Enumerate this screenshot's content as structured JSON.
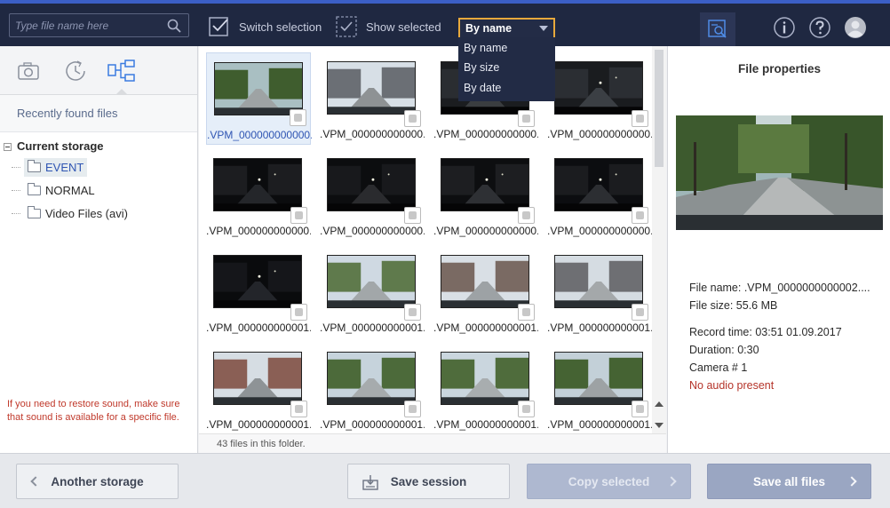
{
  "search": {
    "placeholder": "Type file name here"
  },
  "toolbar": {
    "switch_selection": "Switch selection",
    "show_selected": "Show selected",
    "sort_value": "By name",
    "sort_options": [
      "By name",
      "By size",
      "By date"
    ]
  },
  "left": {
    "recent": "Recently found files",
    "storage_root": "Current storage",
    "folders": [
      "EVENT",
      "NORMAL",
      "Video Files (avi)"
    ],
    "note": "If you need to restore sound, make sure that sound is available for a specific file."
  },
  "grid": {
    "files": [
      ".VPM_000000000000...",
      ".VPM_000000000000...",
      ".VPM_000000000000...",
      ".VPM_000000000000...",
      ".VPM_000000000000...",
      ".VPM_000000000000...",
      ".VPM_000000000000...",
      ".VPM_000000000000...",
      ".VPM_000000000001...",
      ".VPM_000000000001...",
      ".VPM_000000000001...",
      ".VPM_000000000001...",
      ".VPM_000000000001...",
      ".VPM_000000000001...",
      ".VPM_000000000001...",
      ".VPM_000000000001..."
    ],
    "count_text": "43 files in this folder."
  },
  "props": {
    "title": "File properties",
    "file_name": "File name:  .VPM_0000000000002....",
    "file_size": "File size:    55.6 MB",
    "record_time": "Record time:   03:51 01.09.2017",
    "duration": "Duration:   0:30",
    "camera": "Camera # 1",
    "audio": "No audio present"
  },
  "buttons": {
    "another_storage": "Another storage",
    "save_session": "Save session",
    "copy_selected": "Copy selected",
    "save_all": "Save all files"
  },
  "colors": {
    "topbar": "#1f2841",
    "accent": "#3b5fc6",
    "sort_border": "#e8a93c",
    "warning": "#c0392b"
  }
}
